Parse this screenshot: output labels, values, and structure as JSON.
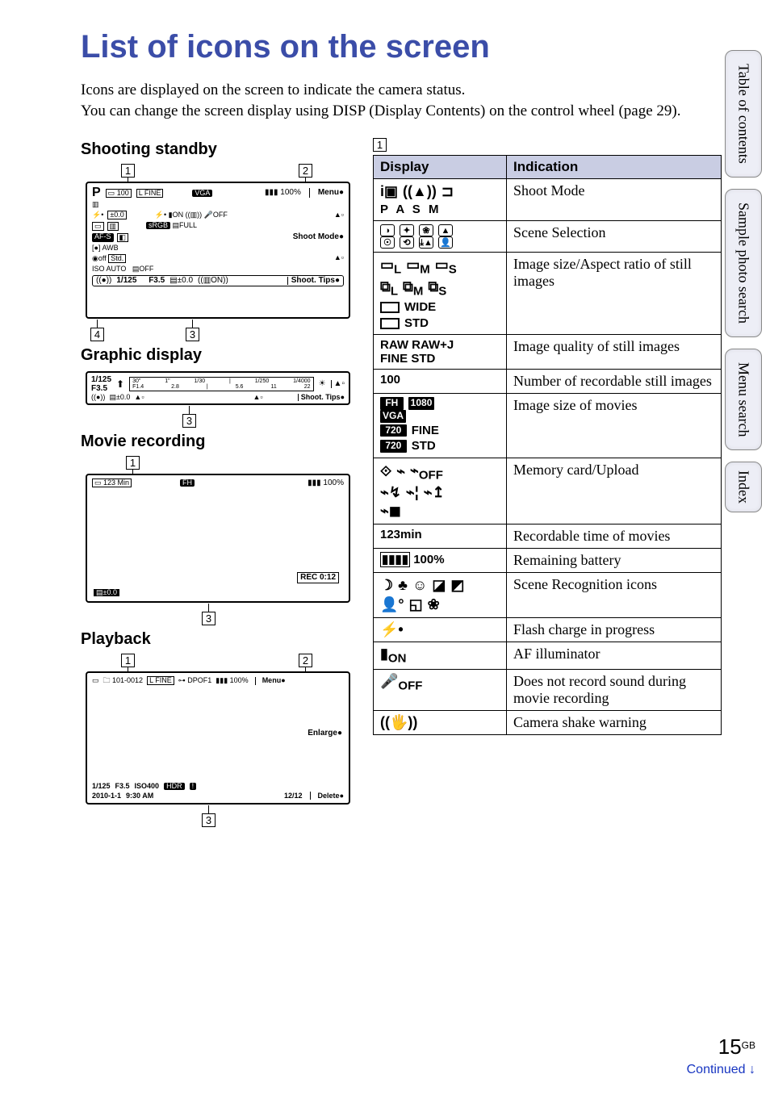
{
  "title": "List of icons on the screen",
  "intro": "Icons are displayed on the screen to indicate the camera status.\nYou can change the screen display using DISP (Display Contents) on the control wheel (page 29).",
  "sections": {
    "shoot": "Shooting standby",
    "graphic": "Graphic display",
    "movie": "Movie recording",
    "playback": "Playback"
  },
  "shoot_lcd": {
    "mode": "P",
    "card": "100",
    "size": "L FINE",
    "movsize": "VGA",
    "batt": "100%",
    "menu": "Menu",
    "flash": "⚡•",
    "af": "AF-S",
    "awb": "AWB",
    "std": "Std.",
    "iso": "ISO AUTO",
    "ev": "±0.0",
    "shutter": "1/125",
    "fnum": "F3.5",
    "ev2": "±0.0",
    "softA": "Shoot Mode",
    "softB": "Shoot. Tips"
  },
  "graphic_lcd": {
    "shutter": "1/125",
    "fnum": "F3.5",
    "ev": "±0.0",
    "ticks_top": [
      "30\"",
      "1\"",
      "1/30",
      "1/250",
      "1/4000"
    ],
    "ticks_bot": [
      "F1.4",
      "2.8",
      "5.6",
      "11",
      "22"
    ],
    "softB": "Shoot. Tips"
  },
  "movie_lcd": {
    "time": "123 Min",
    "size": "FH",
    "batt": "100%",
    "rec": "REC 0:12",
    "ev": "±0.0"
  },
  "play_lcd": {
    "folder": "101-0012",
    "size": "L FINE",
    "dpof": "DPOF1",
    "batt": "100%",
    "menu": "Menu",
    "enlarge": "Enlarge",
    "shutter": "1/125",
    "fnum": "F3.5",
    "iso": "ISO400",
    "date": "2010-1-1",
    "clock": "9:30 AM",
    "counter": "12/12",
    "delete": "Delete"
  },
  "table": {
    "region": "1",
    "head_display": "Display",
    "head_indication": "Indication",
    "rows": [
      {
        "d": "i▣ ((▲)) ▭\nP A S M",
        "i": "Shoot Mode"
      },
      {
        "d": "scene-icons",
        "i": "Scene Selection"
      },
      {
        "d": "size-still",
        "i": "Image size/Aspect ratio of still images"
      },
      {
        "d": "RAW RAW+J FINE STD",
        "i": "Image quality of still images"
      },
      {
        "d": "100",
        "i": "Number of recordable still images"
      },
      {
        "d": "size-movie",
        "i": "Image size of movies"
      },
      {
        "d": "card-icons",
        "i": "Memory card/Upload"
      },
      {
        "d": "123min",
        "i": "Recordable time of movies"
      },
      {
        "d": "▮▮▮▮ 100%",
        "i": "Remaining battery"
      },
      {
        "d": "scene-rec",
        "i": "Scene Recognition icons"
      },
      {
        "d": "⚡•",
        "i": "Flash charge in progress"
      },
      {
        "d": "▮ON",
        "i": "AF illuminator"
      },
      {
        "d": "🎤OFF",
        "i": "Does not record sound during movie recording"
      },
      {
        "d": "((🖐))",
        "i": "Camera shake warning"
      }
    ]
  },
  "tabs": [
    "Table of contents",
    "Sample photo search",
    "Menu search",
    "Index"
  ],
  "page_num": "15",
  "page_suffix": "GB",
  "continued": "Continued ↓"
}
